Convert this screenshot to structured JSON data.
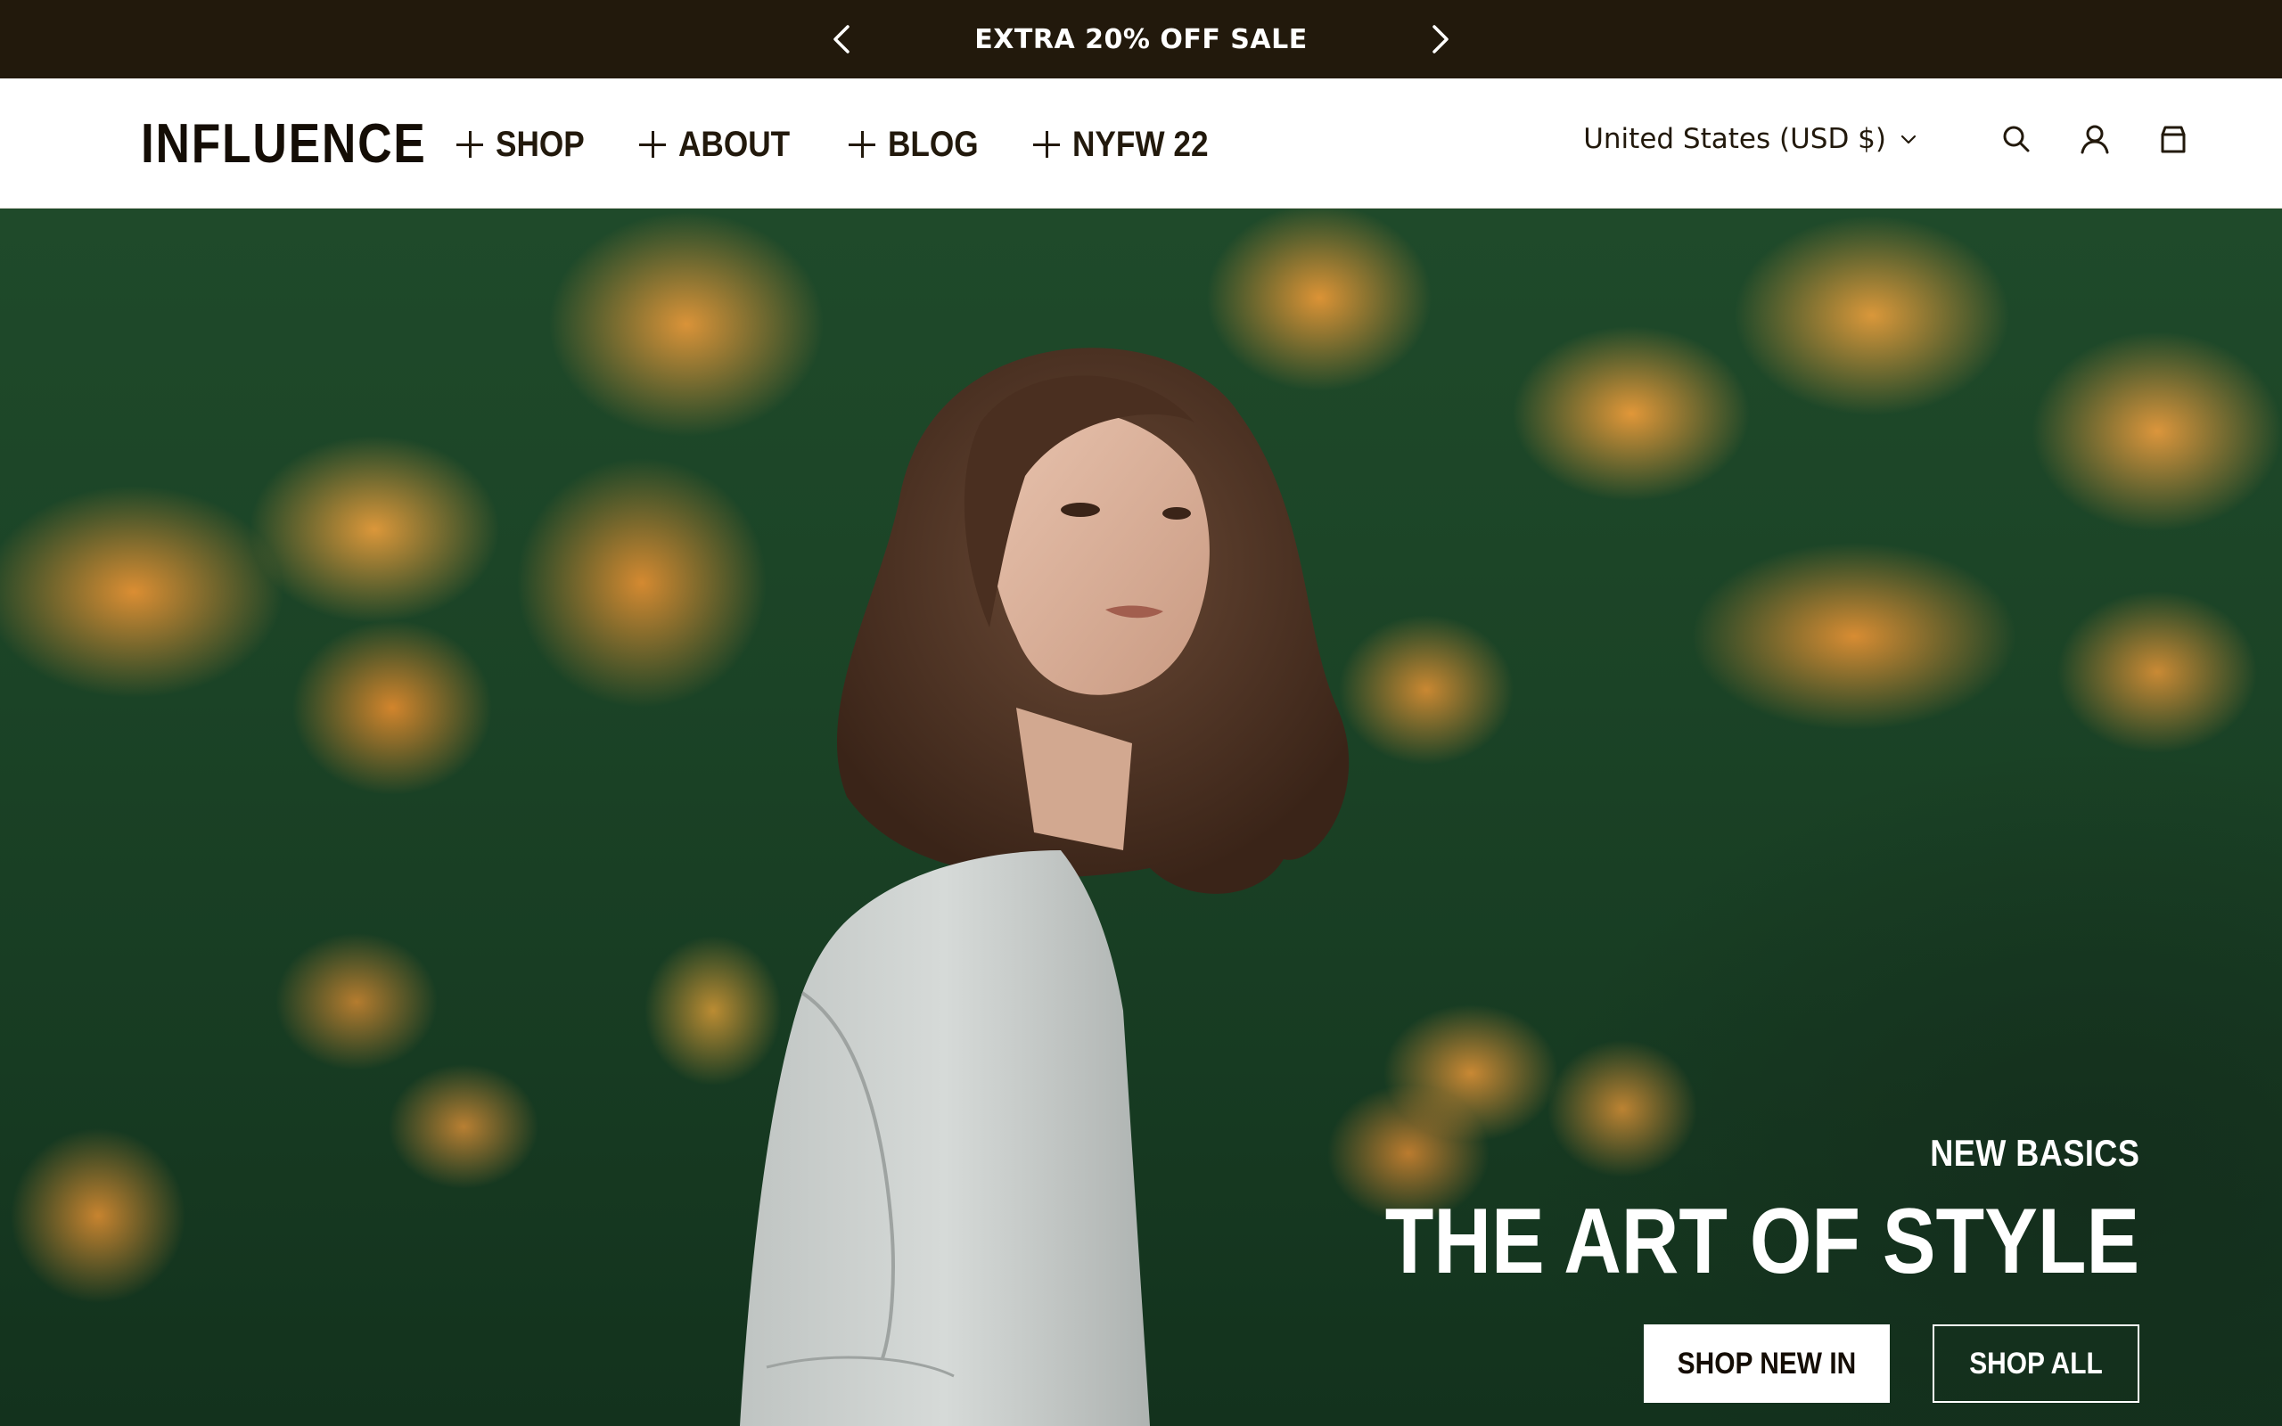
{
  "announcement": {
    "text": "EXTRA 20% OFF SALE",
    "prev_icon": "chevron-left-icon",
    "next_icon": "chevron-right-icon"
  },
  "header": {
    "logo": "INFLUENCE",
    "nav": [
      {
        "label": "SHOP",
        "icon": "plus-icon"
      },
      {
        "label": "ABOUT",
        "icon": "plus-icon"
      },
      {
        "label": "BLOG",
        "icon": "plus-icon"
      },
      {
        "label": "NYFW 22",
        "icon": "plus-icon"
      }
    ],
    "country_selector": "United States (USD $)",
    "icons": [
      "search-icon",
      "account-icon",
      "cart-icon"
    ]
  },
  "hero": {
    "kicker": "NEW BASICS",
    "title": "THE ART OF STYLE",
    "primary_button": "SHOP NEW IN",
    "secondary_button": "SHOP ALL"
  },
  "colors": {
    "announcement_bg": "#22190c",
    "text_dark": "#22190c",
    "foliage": "#1b4326",
    "flowers": "#ec9a3a"
  }
}
